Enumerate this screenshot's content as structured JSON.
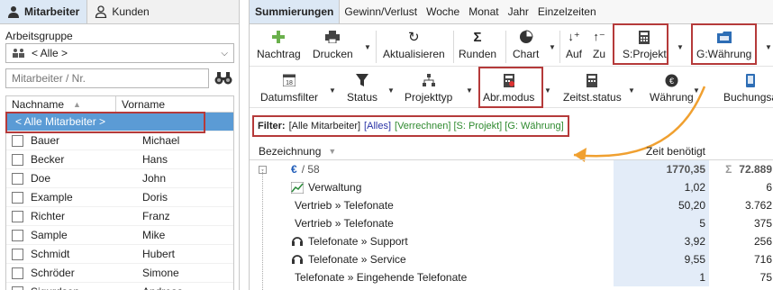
{
  "left": {
    "tabs": [
      {
        "label": "Mitarbeiter",
        "icon": "person-icon",
        "active": true
      },
      {
        "label": "Kunden",
        "icon": "person-outline-icon",
        "active": false
      }
    ],
    "group_label": "Arbeitsgruppe",
    "group_value": "< Alle >",
    "search_placeholder": "Mitarbeiter / Nr.",
    "columns": [
      "Nachname",
      "Vorname"
    ],
    "all_row": "< Alle Mitarbeiter >",
    "rows": [
      {
        "last": "Bauer",
        "first": "Michael"
      },
      {
        "last": "Becker",
        "first": "Hans"
      },
      {
        "last": "Doe",
        "first": "John"
      },
      {
        "last": "Example",
        "first": "Doris"
      },
      {
        "last": "Richter",
        "first": "Franz"
      },
      {
        "last": "Sample",
        "first": "Mike"
      },
      {
        "last": "Schmidt",
        "first": "Hubert"
      },
      {
        "last": "Schröder",
        "first": "Simone"
      },
      {
        "last": "Sigurdson",
        "first": "Andreas"
      }
    ]
  },
  "right": {
    "tabs": [
      "Summierungen",
      "Gewinn/Verlust",
      "Woche",
      "Monat",
      "Jahr",
      "Einzelzeiten"
    ],
    "toolbar1": [
      "Nachtrag",
      "Drucken",
      "Aktualisieren",
      "Runden",
      "Chart",
      "Auf",
      "Zu",
      "S:Projekt",
      "G:Währung"
    ],
    "toolbar2": [
      "Datumsfilter",
      "Status",
      "Projekttyp",
      "Abr.modus",
      "Zeitst.status",
      "Währung",
      "Buchungsa"
    ],
    "filter": {
      "label": "Filter:",
      "main": "[Alle Mitarbeiter]",
      "alles": "[Alles]",
      "rest": "[Verrechnen] [S: Projekt] [G: Währung]"
    },
    "grid": {
      "col_name": "Bezeichnung",
      "col_time": "Zeit benötigt",
      "sum_row": {
        "symbol": "€",
        "count": "/ 58",
        "time": "1770,35",
        "sigma": "Σ",
        "amount": "72.889"
      },
      "rows": [
        {
          "name": "Verwaltung",
          "icon": "chart-icon",
          "time": "1,02",
          "amount": "6"
        },
        {
          "name": "Vertrieb » Telefonate",
          "icon": "",
          "time": "50,20",
          "amount": "3.762"
        },
        {
          "name": "Vertrieb » Telefonate",
          "icon": "",
          "time": "5",
          "amount": "375"
        },
        {
          "name": "Telefonate » Support",
          "icon": "headset-icon",
          "time": "3,92",
          "amount": "256"
        },
        {
          "name": "Telefonate » Service",
          "icon": "headset-icon",
          "time": "9,55",
          "amount": "716"
        },
        {
          "name": "Telefonate » Eingehende Telefonate",
          "icon": "",
          "time": "1",
          "amount": "75"
        }
      ]
    }
  }
}
